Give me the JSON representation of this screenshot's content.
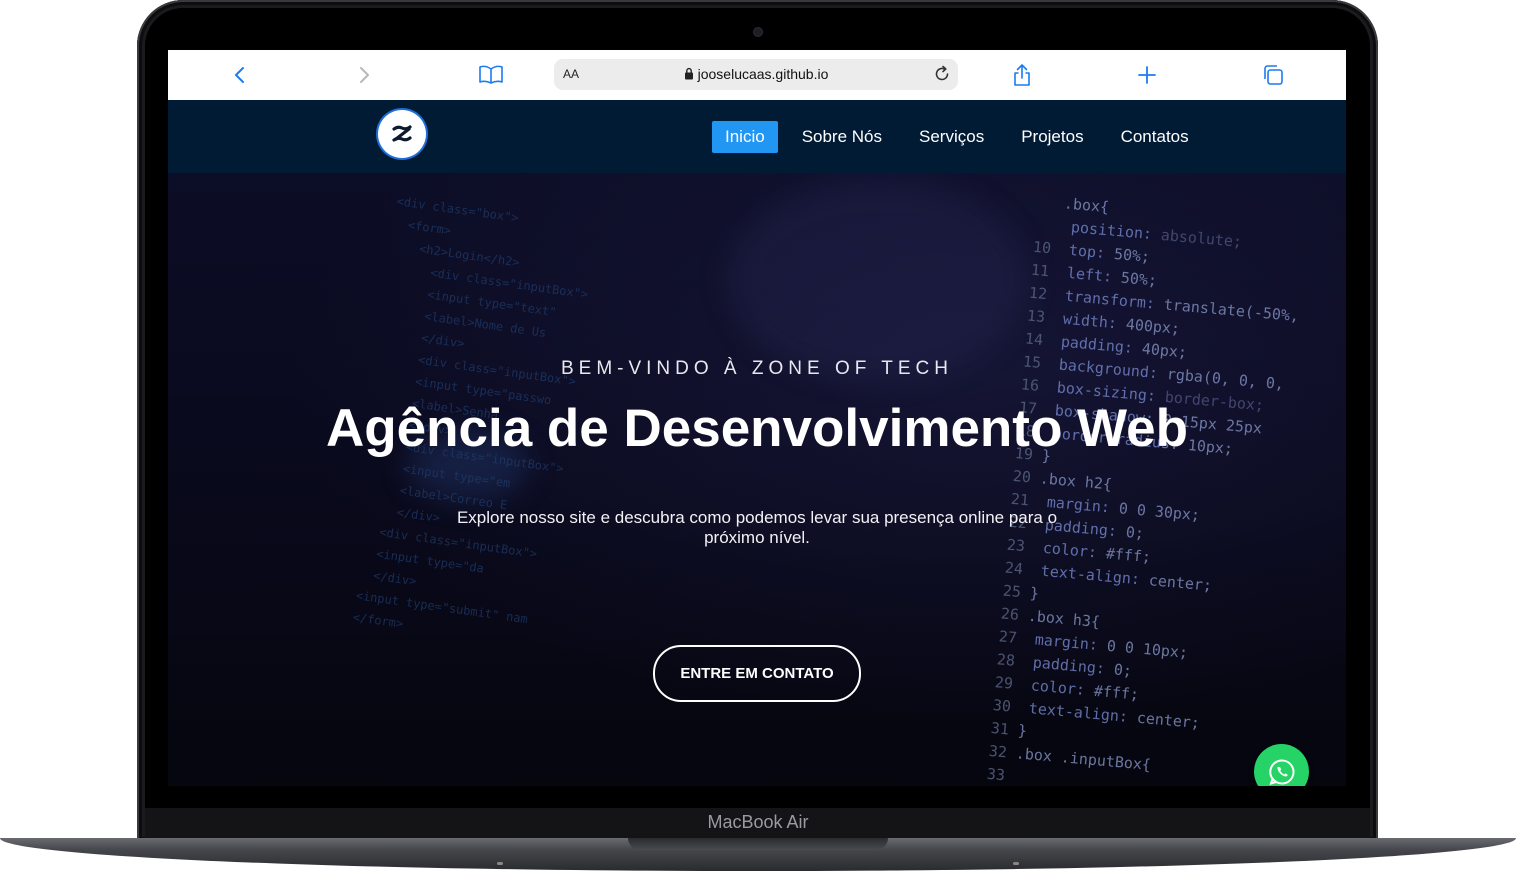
{
  "device": {
    "model_label": "MacBook Air"
  },
  "browser": {
    "text_size_label": "AA",
    "url": "jooselucaas.github.io",
    "icons": [
      "chevron-left-icon",
      "chevron-right-icon",
      "bookmarks-icon",
      "lock-icon",
      "reload-icon",
      "share-icon",
      "plus-icon",
      "tabs-icon"
    ]
  },
  "site": {
    "logo_letter": "z",
    "nav": [
      {
        "label": "Inicio",
        "active": true
      },
      {
        "label": "Sobre Nós",
        "active": false
      },
      {
        "label": "Serviços",
        "active": false
      },
      {
        "label": "Projetos",
        "active": false
      },
      {
        "label": "Contatos",
        "active": false
      }
    ],
    "hero": {
      "welcome": "BEM-VINDO À ZONE OF TECH",
      "headline": "Agência de Desenvolvimento Web",
      "description": "Explore nosso site e descubra como podemos levar sua presença online para o próximo nível.",
      "cta_label": "ENTRE EM CONTATO"
    },
    "whatsapp_icon": "whatsapp-icon",
    "colors": {
      "nav_bg": "#021b35",
      "active_bg": "#2196f3",
      "whatsapp": "#25d366"
    }
  }
}
